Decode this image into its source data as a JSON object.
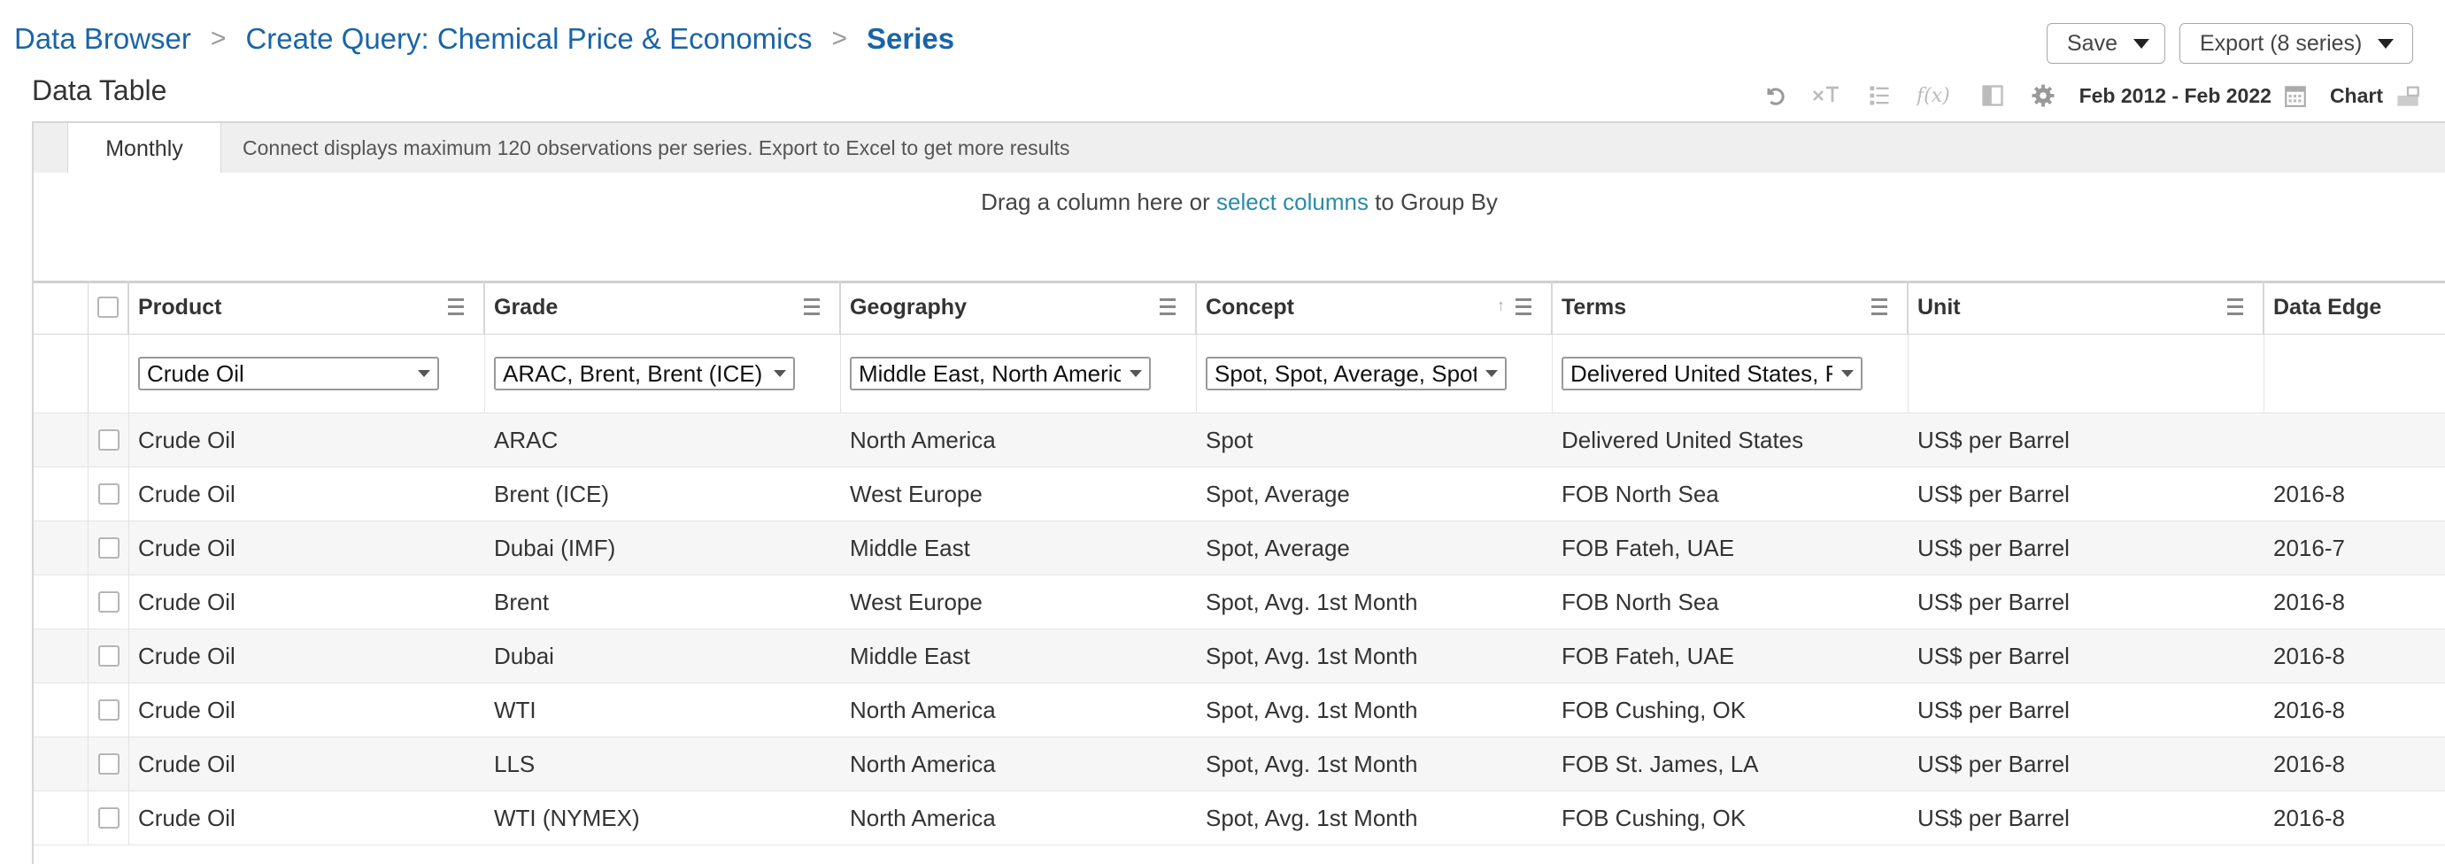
{
  "breadcrumb": {
    "items": [
      "Data Browser",
      "Create Query: Chemical Price & Economics"
    ],
    "current": "Series",
    "separator": ">"
  },
  "actions": {
    "save": "Save",
    "export": "Export (8 series)"
  },
  "table": {
    "title": "Data Table",
    "date_range": "Feb 2012 - Feb 2022",
    "chart_label": "Chart",
    "tab": "Monthly",
    "notice": "Connect displays maximum 120 observations per series. Export to Excel to get more results",
    "groupby_prefix": "Drag a column here or ",
    "groupby_link": "select columns",
    "groupby_suffix": " to Group By",
    "columns": [
      "Product",
      "Grade",
      "Geography",
      "Concept",
      "Terms",
      "Unit",
      "Data Edge"
    ],
    "filters": {
      "product": "Crude Oil",
      "grade": "ARAC, Brent, Brent (ICE)",
      "geography": "Middle East, North America",
      "concept": "Spot, Spot, Average, Spot",
      "terms": "Delivered United States, FOB"
    },
    "rows": [
      [
        "Crude Oil",
        "ARAC",
        "North America",
        "Spot",
        "Delivered United States",
        "US$ per Barrel",
        ""
      ],
      [
        "Crude Oil",
        "Brent (ICE)",
        "West Europe",
        "Spot, Average",
        "FOB North Sea",
        "US$ per Barrel",
        "2016-8"
      ],
      [
        "Crude Oil",
        "Dubai (IMF)",
        "Middle East",
        "Spot, Average",
        "FOB Fateh, UAE",
        "US$ per Barrel",
        "2016-7"
      ],
      [
        "Crude Oil",
        "Brent",
        "West Europe",
        "Spot, Avg. 1st Month",
        "FOB North Sea",
        "US$ per Barrel",
        "2016-8"
      ],
      [
        "Crude Oil",
        "Dubai",
        "Middle East",
        "Spot, Avg. 1st Month",
        "FOB Fateh, UAE",
        "US$ per Barrel",
        "2016-8"
      ],
      [
        "Crude Oil",
        "WTI",
        "North America",
        "Spot, Avg. 1st Month",
        "FOB Cushing, OK",
        "US$ per Barrel",
        "2016-8"
      ],
      [
        "Crude Oil",
        "LLS",
        "North America",
        "Spot, Avg. 1st Month",
        "FOB St. James, LA",
        "US$ per Barrel",
        "2016-8"
      ],
      [
        "Crude Oil",
        "WTI (NYMEX)",
        "North America",
        "Spot, Avg. 1st Month",
        "FOB Cushing, OK",
        "US$ per Barrel",
        "2016-8"
      ]
    ]
  },
  "toolbar_icons": [
    "undo-icon",
    "clear-format-icon",
    "list-icon",
    "function-icon",
    "columns-icon",
    "gear-icon",
    "calendar-icon",
    "chart-icon"
  ]
}
